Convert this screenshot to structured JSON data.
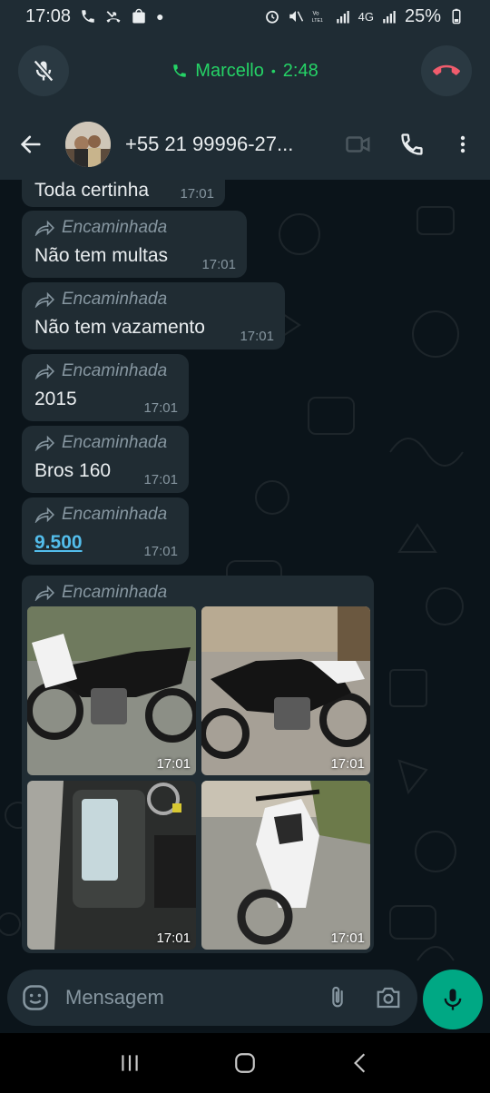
{
  "status_bar": {
    "time": "17:08",
    "battery": "25%",
    "network_labels": "4G"
  },
  "call": {
    "contact": "Marcello",
    "separator": "•",
    "duration": "2:48"
  },
  "header": {
    "contact_title": "+55 21 99996-27..."
  },
  "messages": [
    {
      "forward_label": "",
      "text": "Toda certinha",
      "time": "17:01"
    },
    {
      "forward_label": "Encaminhada",
      "text": "Não tem multas",
      "time": "17:01"
    },
    {
      "forward_label": "Encaminhada",
      "text": "Não tem vazamento",
      "time": "17:01"
    },
    {
      "forward_label": "Encaminhada",
      "text": "2015",
      "time": "17:01"
    },
    {
      "forward_label": "Encaminhada",
      "text": "Bros 160",
      "time": "17:01"
    },
    {
      "forward_label": "Encaminhada",
      "text": "9.500",
      "time": "17:01"
    }
  ],
  "album": {
    "forward_label": "Encaminhada",
    "photos": [
      {
        "time": "17:01"
      },
      {
        "time": "17:01"
      },
      {
        "time": "17:01"
      },
      {
        "time": "17:01"
      }
    ]
  },
  "composer": {
    "placeholder": "Mensagem"
  },
  "colors": {
    "accent": "#00a884",
    "call_green": "#25d366",
    "end_call_red": "#f15c6d",
    "bubble": "#202c33",
    "background": "#0b141a"
  },
  "icons": [
    "mute-icon",
    "end-call-icon",
    "back-icon",
    "video-icon",
    "phone-icon",
    "more-icon",
    "forward-icon",
    "emoji-icon",
    "attach-icon",
    "camera-icon",
    "mic-icon",
    "recents-icon",
    "home-icon",
    "back-nav-icon"
  ]
}
